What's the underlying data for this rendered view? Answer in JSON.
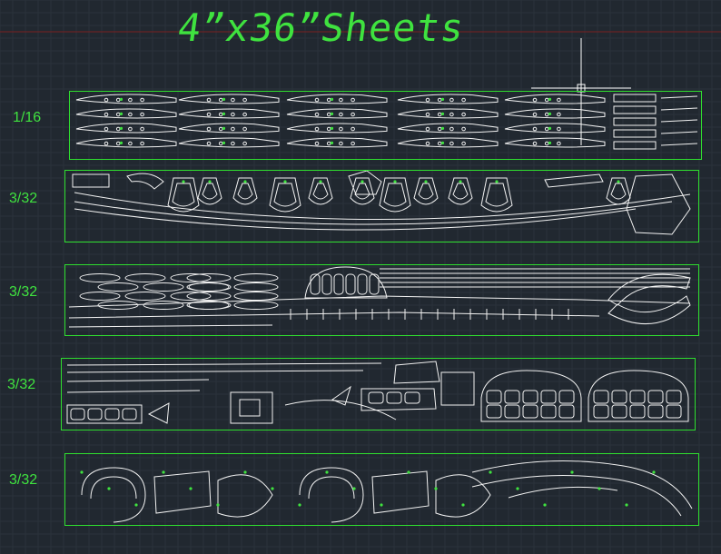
{
  "title": "4”x36”Sheets",
  "sheets": [
    {
      "thickness": "1/16"
    },
    {
      "thickness": "3/32"
    },
    {
      "thickness": "3/32"
    },
    {
      "thickness": "3/32"
    },
    {
      "thickness": "3/32"
    }
  ],
  "colors": {
    "background": "#212830",
    "grid": "#2a323b",
    "outline": "#2fe02f",
    "parts": "#f2f2f2",
    "labels": "#3fe23f"
  }
}
